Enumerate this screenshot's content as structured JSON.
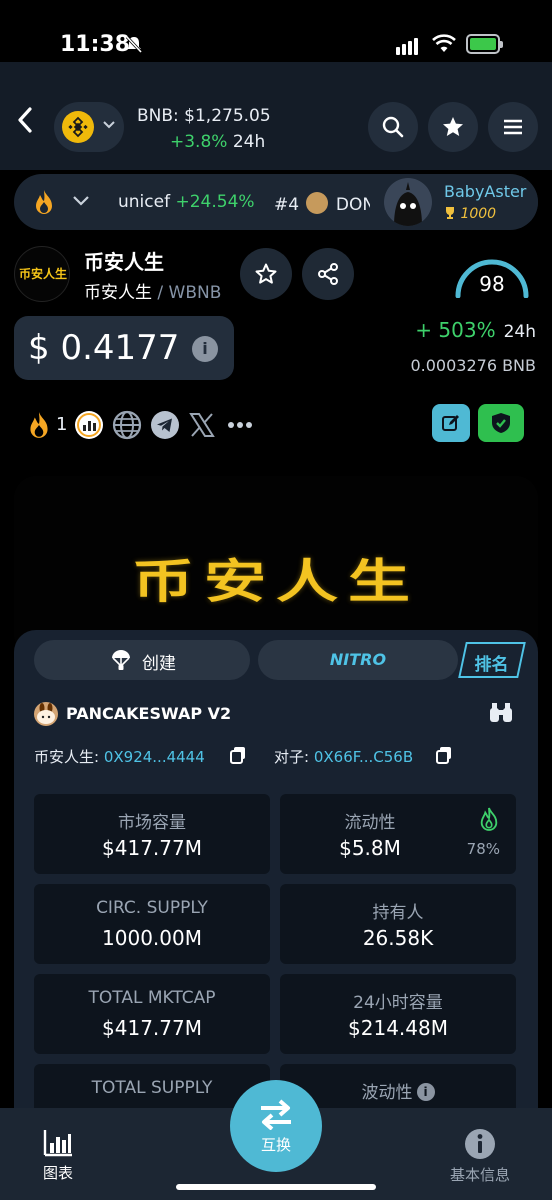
{
  "status_bar": {
    "time": "11:38"
  },
  "header": {
    "bnb_price": "BNB: $1,275.05",
    "bnb_change": "+3.8%",
    "bnb_change_unit": "24h"
  },
  "ticker": {
    "item1_name": "unicef",
    "item1_change": "+24.54%",
    "item2": "#4",
    "item2_name": "DON",
    "user_name": "BabyAster",
    "user_score": "1000"
  },
  "token": {
    "logo_text": "币安人生",
    "name": "币安人生",
    "pair_base": "币安人生",
    "pair_quote": "WBNB",
    "score": "98",
    "price": "$ 0.4177",
    "change_24h": "+ 503%",
    "change_unit": "24h",
    "price_bnb": "0.0003276  BNB",
    "hot_count": "1"
  },
  "banner": {
    "text": "币安人生"
  },
  "panel": {
    "tab_create": "创建",
    "tab_nitro": "NITRO",
    "tab_rank": "排名",
    "dex_name": "PANCAKESWAP V2",
    "token_addr_label": "币安人生:",
    "token_addr": "0X924...4444",
    "pair_addr_label": "对子:",
    "pair_addr": "0X66F...C56B",
    "stats": [
      {
        "label": "市场容量",
        "value": "$417.77M"
      },
      {
        "label": "流动性",
        "value": "$5.8M",
        "extra": "78%"
      },
      {
        "label": "CIRC. SUPPLY",
        "value": "1000.00M"
      },
      {
        "label": "持有人",
        "value": "26.58K"
      },
      {
        "label": "TOTAL MKTCAP",
        "value": "$417.77M"
      },
      {
        "label": "24小时容量",
        "value": "$214.48M"
      },
      {
        "label": "TOTAL SUPPLY",
        "value": ""
      },
      {
        "label": "波动性",
        "value": ""
      }
    ]
  },
  "bottom_nav": {
    "chart": "图表",
    "swap": "互换",
    "info": "基本信息"
  },
  "colors": {
    "accent": "#4fc3e6",
    "positive": "#3ed16b",
    "bnb": "#f0b90b",
    "banner_text": "#f3c321"
  }
}
